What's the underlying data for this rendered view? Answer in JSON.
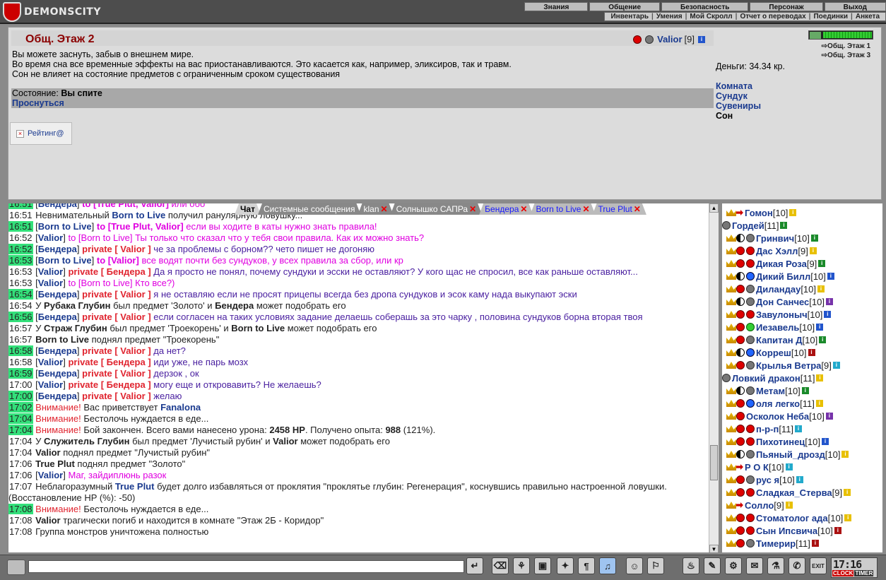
{
  "logo": {
    "text": "DEMONSCITY"
  },
  "menu1": [
    "Знания",
    "Общение",
    "Безопасность",
    "Персонаж",
    "Выход"
  ],
  "menu2": [
    "Инвентарь",
    "Умения",
    "Мой Скролл",
    "Отчет о переводах",
    "Поединки",
    "Анкета"
  ],
  "room": {
    "title": "Общ. Этаж 2",
    "user": {
      "name": "Valior",
      "level": "[9]"
    },
    "desc": [
      "Вы можете заснуть, забыв о внешнем мире.",
      "Во время сна все временные эффекты на вас приостанавливаются. Это касается как, например, эликсиров, так и травм.",
      "Сон не влияет на состояние предметов с ограниченным сроком существования"
    ],
    "status_label": "Состояние:",
    "status_value": "Вы спите",
    "wake_link": "Проснуться",
    "rating": "Рейтинг@"
  },
  "right": {
    "exits": [
      "Общ. Этаж 1",
      "Общ. Этаж 3"
    ],
    "money": "Деньги: 34.34 кр.",
    "links": [
      "Комната",
      "Сундук",
      "Сувениры"
    ],
    "current": "Сон"
  },
  "tabs": [
    {
      "label": "Чат",
      "active": true,
      "close": false
    },
    {
      "label": "Системные сообщения",
      "active": false,
      "close": false
    },
    {
      "label": "klan",
      "active": false,
      "close": true
    },
    {
      "label": "Солнышко САПРа",
      "active": false,
      "close": true
    },
    {
      "label": "Бендера",
      "active": false,
      "close": true,
      "priv": true
    },
    {
      "label": "Born to Live",
      "active": false,
      "close": true,
      "priv": true
    },
    {
      "label": "True Plut",
      "active": false,
      "close": true,
      "priv": true
    }
  ],
  "chat": [
    {
      "t": "16:51",
      "g": true,
      "html": "[<span class='nm'>Бендера</span>] <span class='to'>to [True Plut, Valior]</span> <span class='pinkmsg'>или обо</span>"
    },
    {
      "t": "16:51",
      "g": false,
      "html": "Невнимательный <span class='nm'>Born to Live</span> получил ранулярную ловушку..."
    },
    {
      "t": "16:51",
      "g": true,
      "html": "[<span class='nm'>Born to Live</span>] <span class='to'>to [True Plut, Valior]</span> <span class='pinkmsg'>если вы ходите в каты нужно знать правила!</span>"
    },
    {
      "t": "16:52",
      "g": false,
      "html": "[<span class='nm'>Valior</span>] <span class='pinkmsg'>to [Born to Live] Ты только что сказал что у тебя свои правила. Как их можно знать?</span>"
    },
    {
      "t": "16:52",
      "g": true,
      "html": "[<span class='nm'>Бендера</span>] <span class='pv'>private [ Valior ]</span> <span class='msg'>че за проблемы с борном?? чето пишет не догоняю</span>"
    },
    {
      "t": "16:53",
      "g": true,
      "html": "[<span class='nm'>Born to Live</span>] <span class='to'>to [Valior]</span> <span class='pinkmsg'>все водят почти без сундуков, у всех правила за сбор, или кр</span>"
    },
    {
      "t": "16:53",
      "g": false,
      "html": "[<span class='nm'>Valior</span>] <span class='pv'>private [ Бендера ]</span> <span class='msg'>Да я просто не понял, почему сундуки и эсски не оставляют? У кого щас не спросил, все как раньше оставляют...</span>"
    },
    {
      "t": "16:53",
      "g": false,
      "html": "[<span class='nm'>Valior</span>] <span class='pinkmsg'>to [Born to Live] Кто все?)</span>"
    },
    {
      "t": "16:54",
      "g": true,
      "html": "[<span class='nm'>Бендера</span>] <span class='pv'>private [ Valior ]</span> <span class='msg'>я не оставляю если не просят прицепы всегда без дропа сундуков и эсок каму нада выкупают эски</span>"
    },
    {
      "t": "16:54",
      "g": false,
      "html": "У <span class='b'>Рубака Глубин</span> был предмет 'Золото' и <span class='b'>Бендера</span> может подобрать его"
    },
    {
      "t": "16:56",
      "g": true,
      "html": "[<span class='nm'>Бендера</span>] <span class='pv'>private [ Valior ]</span> <span class='msg'>если согласен на таких условиях задание делаешь соберашь за это чарку , половина сундуков борна вторая твоя</span>"
    },
    {
      "t": "16:57",
      "g": false,
      "html": "У <span class='b'>Страж Глубин</span> был предмет 'Троекорень' и <span class='b'>Born to Live</span> может подобрать его"
    },
    {
      "t": "16:57",
      "g": false,
      "html": "<span class='b'>Born to Live</span> поднял предмет \"Троекорень\""
    },
    {
      "t": "16:58",
      "g": true,
      "html": "[<span class='nm'>Бендера</span>] <span class='pv'>private [ Valior ]</span> <span class='msg'>да нет?</span>"
    },
    {
      "t": "16:58",
      "g": false,
      "html": "[<span class='nm'>Valior</span>] <span class='pv'>private [ Бендера ]</span> <span class='msg'>иди уже, не парь мозх</span>"
    },
    {
      "t": "16:59",
      "g": true,
      "html": "[<span class='nm'>Бендера</span>] <span class='pv'>private [ Valior ]</span> <span class='msg'>дерзок , ок</span>"
    },
    {
      "t": "17:00",
      "g": false,
      "html": "[<span class='nm'>Valior</span>] <span class='pv'>private [ Бендера ]</span> <span class='msg'>могу еще и откровавить? Не желаешь?</span>"
    },
    {
      "t": "17:00",
      "g": true,
      "html": "[<span class='nm'>Бендера</span>] <span class='pv'>private [ Valior ]</span> <span class='msg'>желаю</span>"
    },
    {
      "t": "17:02",
      "g": true,
      "html": "<span class='warn'>Внимание!</span> Вас приветствует <span class='nm'>Fanalona</span>"
    },
    {
      "t": "17:04",
      "g": true,
      "html": "<span class='warn'>Внимание!</span> Бестолочь нуждается в еде..."
    },
    {
      "t": "17:04",
      "g": true,
      "html": "<span class='warn'>Внимание!</span> Бой закончен. Всего вами нанесено урона: <span class='b'>2458 HP</span>. Получено опыта: <span class='b'>988</span> (121%)."
    },
    {
      "t": "17:04",
      "g": false,
      "html": "У <span class='b'>Служитель Глубин</span> был предмет 'Лучистый рубин' и <span class='b'>Valior</span> может подобрать его"
    },
    {
      "t": "17:04",
      "g": false,
      "html": "<span class='b'>Valior</span> поднял предмет \"Лучистый рубин\""
    },
    {
      "t": "17:06",
      "g": false,
      "html": "<span class='b'>True Plut</span> поднял предмет \"Золото\""
    },
    {
      "t": "17:06",
      "g": false,
      "html": "[<span class='nm'>Valior</span>] <span class='pinkmsg'>Маг, зайдиплюнь разок</span>"
    },
    {
      "t": "17:07",
      "g": false,
      "html": "Неблагоразумный <span class='nm'>True Plut</span> будет долго избавляться от проклятия \"проклятье глубин: Регенерация\", коснувшись правильно настроенной ловушки. (Восстановление HP (%): -50)"
    },
    {
      "t": "17:08",
      "g": true,
      "html": "<span class='warn'>Внимание!</span> Бестолочь нуждается в еде..."
    },
    {
      "t": "17:08",
      "g": false,
      "html": "<span class='b'>Valior</span> трагически погиб и находится в комнате \"Этаж 2Б - Коридор\""
    },
    {
      "t": "17:08",
      "g": false,
      "html": "Группа монстров уничтожена полностью"
    }
  ],
  "users": [
    {
      "n": "Гомон",
      "l": "[10]",
      "i": "y",
      "icons": [
        "crown",
        "arrow"
      ]
    },
    {
      "n": "Гордей",
      "l": "[11]",
      "i": "g",
      "icons": [
        "gray"
      ]
    },
    {
      "n": "Гринвич",
      "l": "[10]",
      "i": "g",
      "icons": [
        "crown",
        "yy",
        "gray"
      ]
    },
    {
      "n": "Дас Хэлл",
      "l": "[9]",
      "i": "y",
      "icons": [
        "crown",
        "red",
        "red"
      ]
    },
    {
      "n": "Дикая Роза",
      "l": "[9]",
      "i": "g",
      "icons": [
        "crown",
        "red",
        "red"
      ]
    },
    {
      "n": "Дикий Билл",
      "l": "[10]",
      "i": "b",
      "icons": [
        "crown",
        "yy",
        "blue"
      ]
    },
    {
      "n": "Диландау",
      "l": "[10]",
      "i": "y",
      "icons": [
        "crown",
        "red",
        "gray"
      ]
    },
    {
      "n": "Дон Санчес",
      "l": "[10]",
      "i": "p",
      "icons": [
        "crown",
        "yy",
        "gray"
      ]
    },
    {
      "n": "Завулоныч",
      "l": "[10]",
      "i": "b",
      "icons": [
        "crown",
        "red",
        "red"
      ]
    },
    {
      "n": "Иезавель",
      "l": "[10]",
      "i": "b",
      "icons": [
        "crown",
        "red",
        "green"
      ]
    },
    {
      "n": "Капитан Д",
      "l": "[10]",
      "i": "g",
      "icons": [
        "crown",
        "red",
        "gray"
      ]
    },
    {
      "n": "Корреш",
      "l": "[10]",
      "i": "r",
      "icons": [
        "crown",
        "yy",
        "blue"
      ]
    },
    {
      "n": "Крылья Ветра",
      "l": "[9]",
      "i": "c",
      "icons": [
        "crown",
        "red",
        "gray"
      ]
    },
    {
      "n": "Ловкий дракон",
      "l": "[11]",
      "i": "y",
      "icons": [
        "gray"
      ]
    },
    {
      "n": "Метам",
      "l": "[10]",
      "i": "g",
      "icons": [
        "crown",
        "yy",
        "gray"
      ]
    },
    {
      "n": "оля легко",
      "l": "[11]",
      "i": "y",
      "icons": [
        "crown",
        "red",
        "blue"
      ]
    },
    {
      "n": "Осколок Неба",
      "l": "[10]",
      "i": "p",
      "icons": [
        "crown",
        "red"
      ]
    },
    {
      "n": "п-р-п",
      "l": "[11]",
      "i": "c",
      "icons": [
        "crown",
        "red",
        "red"
      ]
    },
    {
      "n": "Пихотинец",
      "l": "[10]",
      "i": "b",
      "icons": [
        "crown",
        "red",
        "red"
      ]
    },
    {
      "n": "Пьяный_дрозд",
      "l": "[10]",
      "i": "y",
      "icons": [
        "crown",
        "yy",
        "gray"
      ]
    },
    {
      "n": "Р О К",
      "l": "[10]",
      "i": "c",
      "icons": [
        "crown",
        "arrow"
      ]
    },
    {
      "n": "рус я",
      "l": "[10]",
      "i": "c",
      "icons": [
        "crown",
        "red",
        "gray"
      ]
    },
    {
      "n": "Сладкая_Стерва",
      "l": "[9]",
      "i": "y",
      "icons": [
        "crown",
        "red",
        "red"
      ]
    },
    {
      "n": "Солло",
      "l": "[9]",
      "i": "y",
      "icons": [
        "crown",
        "arrow"
      ]
    },
    {
      "n": "Стоматолог ада",
      "l": "[10]",
      "i": "y",
      "icons": [
        "crown",
        "red",
        "red"
      ]
    },
    {
      "n": "Сын Ипсвича",
      "l": "[10]",
      "i": "r",
      "icons": [
        "crown",
        "red",
        "red"
      ]
    },
    {
      "n": "Тимерир",
      "l": "[11]",
      "i": "r",
      "icons": [
        "crown",
        "red",
        "gray"
      ]
    }
  ],
  "input": {
    "placeholder": ""
  },
  "toolbar": [
    "↵",
    "⌫",
    "⚘",
    "▣",
    "✦",
    "¶",
    "♫",
    "☺",
    "⚐"
  ],
  "toolbar_right": [
    "♨",
    "✎",
    "⚙",
    "✉",
    "⚗",
    "✆",
    "EXIT"
  ],
  "clock": {
    "time": "17:16",
    "clock_label": "CLOCK",
    "timer_label": "TIMER"
  }
}
